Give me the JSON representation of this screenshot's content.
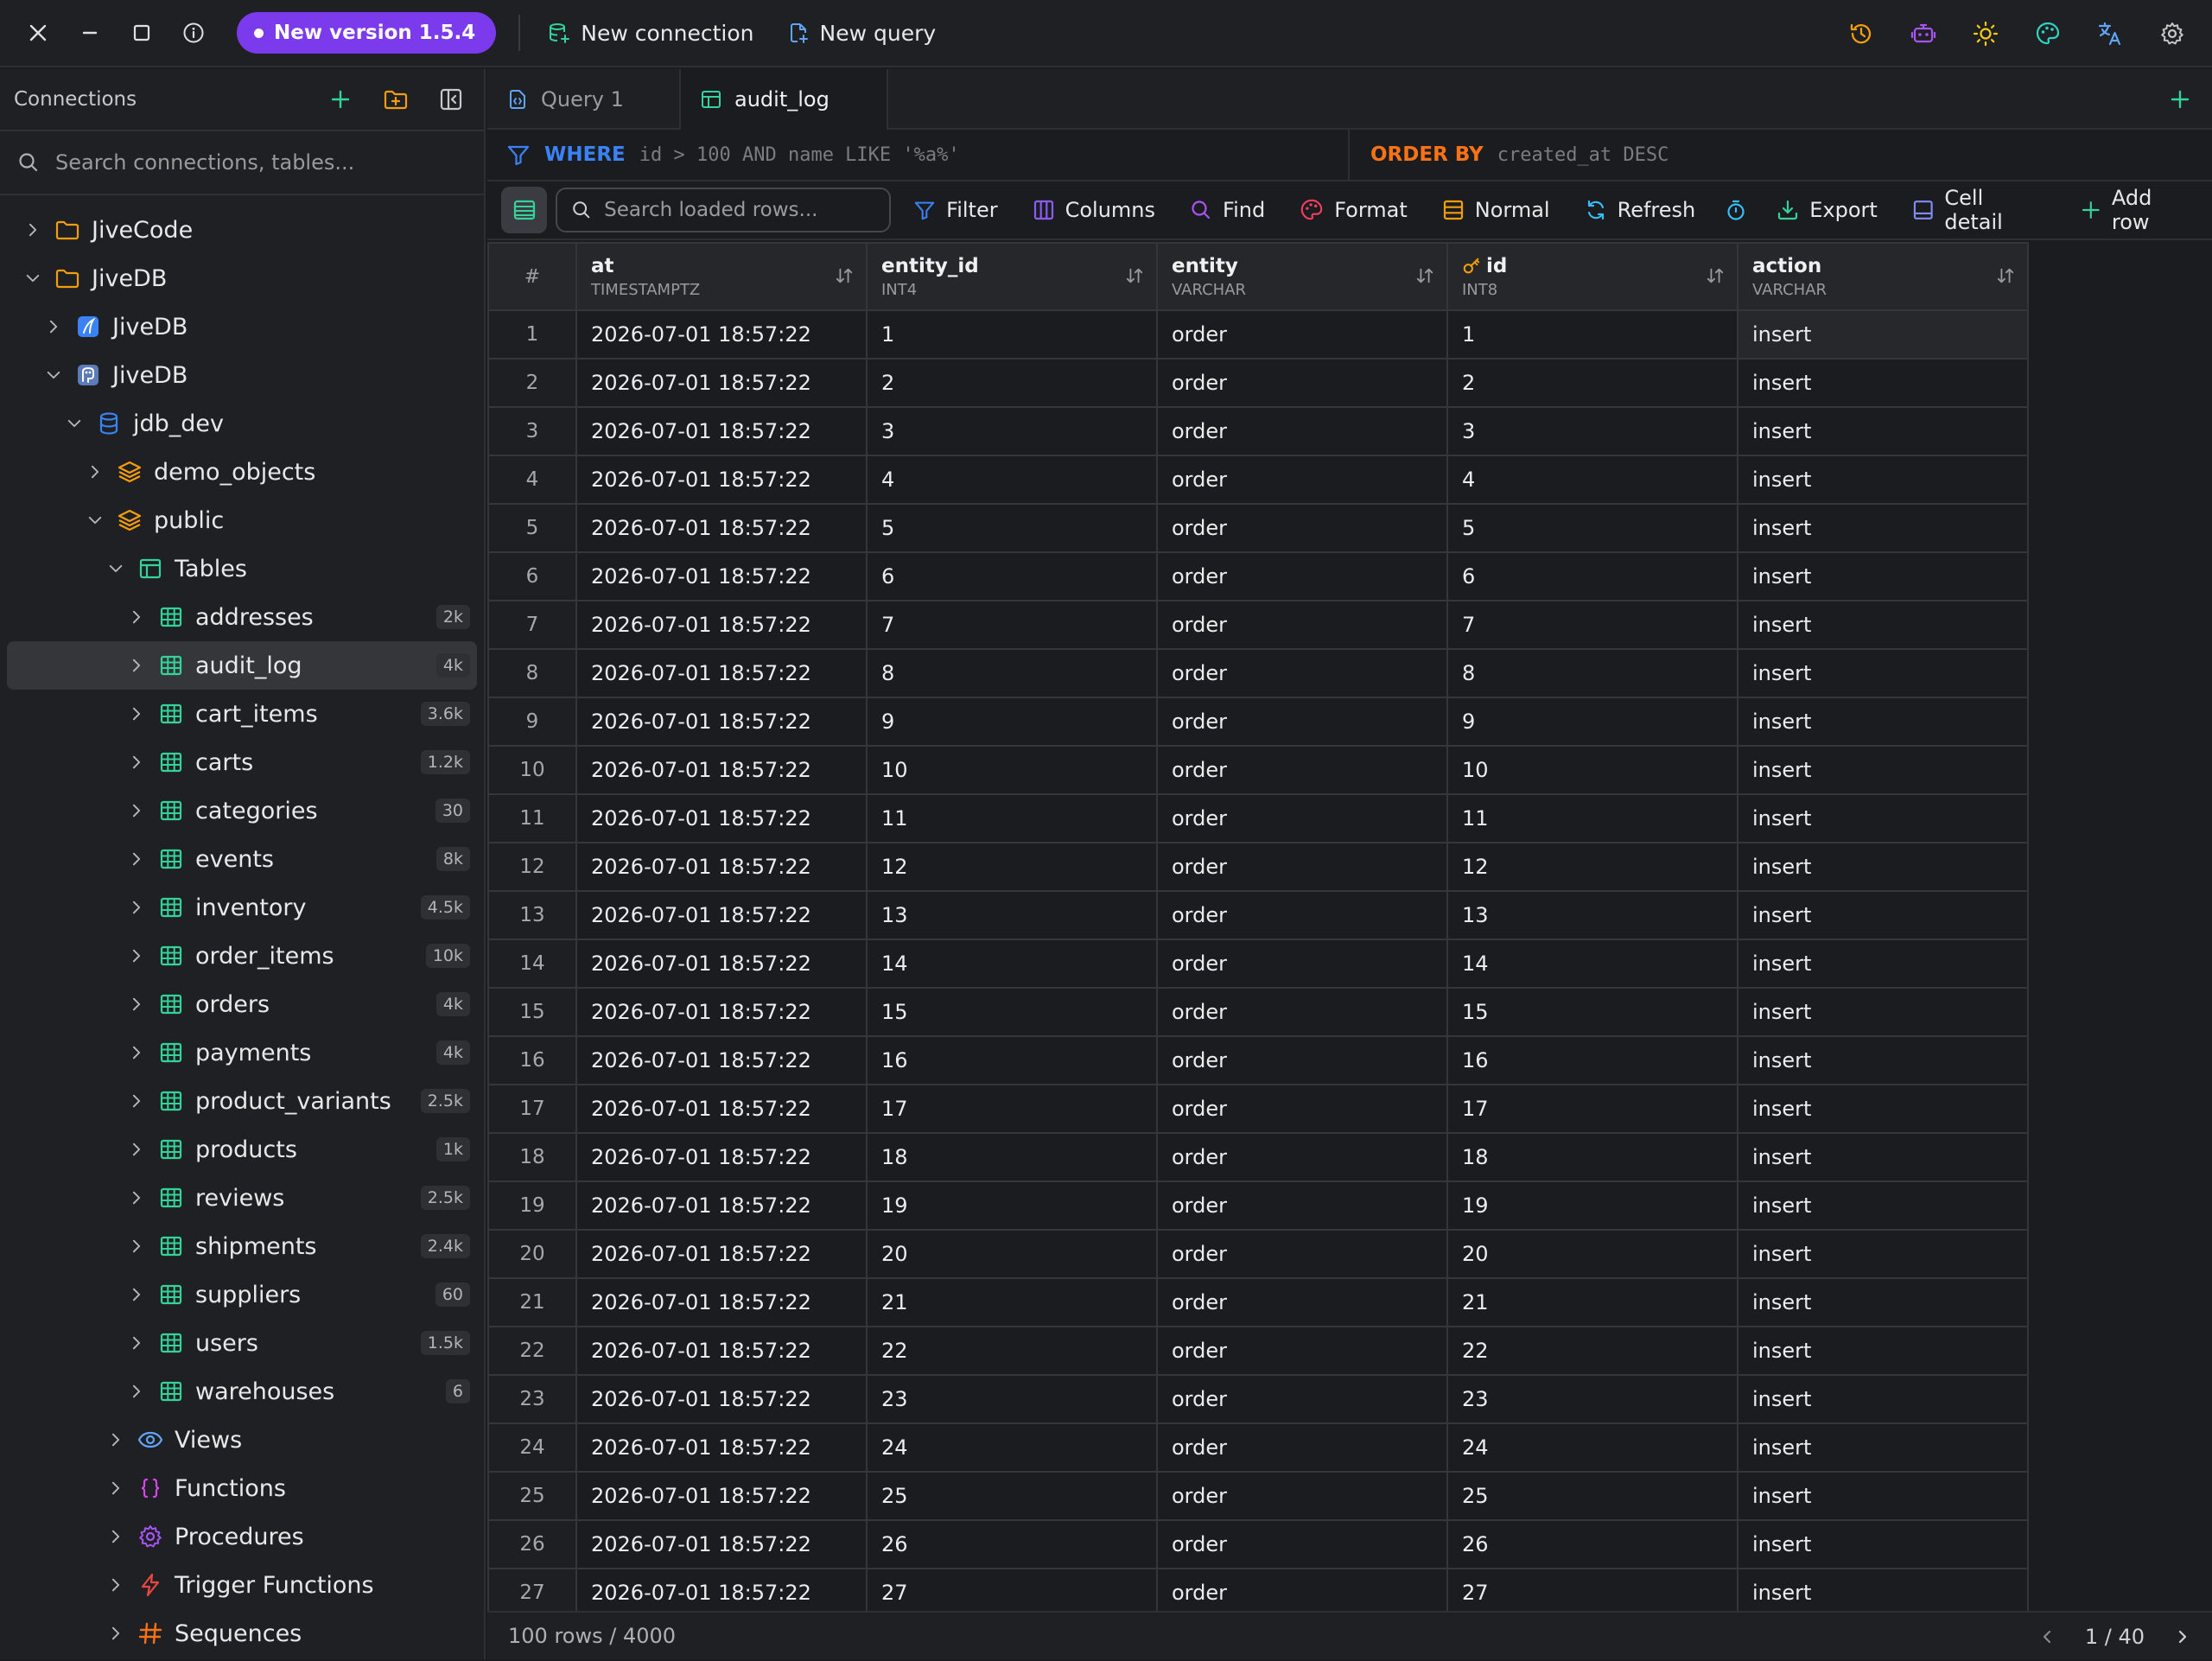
{
  "topbar": {
    "version_badge": "New version 1.5.4",
    "new_connection": "New connection",
    "new_query": "New query"
  },
  "sidebar": {
    "title": "Connections",
    "search_placeholder": "Search connections, tables...",
    "tree": [
      {
        "label": "JiveCode",
        "icon": "folder-icon",
        "level": 0,
        "expanded": false
      },
      {
        "label": "JiveDB",
        "icon": "folder-icon",
        "level": 0,
        "expanded": true
      },
      {
        "label": "JiveDB",
        "icon": "sqlite-icon",
        "level": 1,
        "expanded": false
      },
      {
        "label": "JiveDB",
        "icon": "postgres-icon",
        "level": 1,
        "expanded": true
      },
      {
        "label": "jdb_dev",
        "icon": "database-icon",
        "level": 2,
        "expanded": true
      },
      {
        "label": "demo_objects",
        "icon": "schema-icon",
        "level": 3,
        "expanded": false
      },
      {
        "label": "public",
        "icon": "schema-icon",
        "level": 3,
        "expanded": true
      },
      {
        "label": "Tables",
        "icon": "tables-icon",
        "level": 4,
        "expanded": true
      },
      {
        "label": "addresses",
        "icon": "table-icon",
        "level": 5,
        "count": "2k"
      },
      {
        "label": "audit_log",
        "icon": "table-icon",
        "level": 5,
        "count": "4k",
        "active": true
      },
      {
        "label": "cart_items",
        "icon": "table-icon",
        "level": 5,
        "count": "3.6k"
      },
      {
        "label": "carts",
        "icon": "table-icon",
        "level": 5,
        "count": "1.2k"
      },
      {
        "label": "categories",
        "icon": "table-icon",
        "level": 5,
        "count": "30"
      },
      {
        "label": "events",
        "icon": "table-icon",
        "level": 5,
        "count": "8k"
      },
      {
        "label": "inventory",
        "icon": "table-icon",
        "level": 5,
        "count": "4.5k"
      },
      {
        "label": "order_items",
        "icon": "table-icon",
        "level": 5,
        "count": "10k"
      },
      {
        "label": "orders",
        "icon": "table-icon",
        "level": 5,
        "count": "4k"
      },
      {
        "label": "payments",
        "icon": "table-icon",
        "level": 5,
        "count": "4k"
      },
      {
        "label": "product_variants",
        "icon": "table-icon",
        "level": 5,
        "count": "2.5k"
      },
      {
        "label": "products",
        "icon": "table-icon",
        "level": 5,
        "count": "1k"
      },
      {
        "label": "reviews",
        "icon": "table-icon",
        "level": 5,
        "count": "2.5k"
      },
      {
        "label": "shipments",
        "icon": "table-icon",
        "level": 5,
        "count": "2.4k"
      },
      {
        "label": "suppliers",
        "icon": "table-icon",
        "level": 5,
        "count": "60"
      },
      {
        "label": "users",
        "icon": "table-icon",
        "level": 5,
        "count": "1.5k"
      },
      {
        "label": "warehouses",
        "icon": "table-icon",
        "level": 5,
        "count": "6"
      },
      {
        "label": "Views",
        "icon": "eye-icon",
        "level": 4,
        "expanded": false
      },
      {
        "label": "Functions",
        "icon": "braces-icon",
        "level": 4,
        "expanded": false
      },
      {
        "label": "Procedures",
        "icon": "gear-icon",
        "level": 4,
        "expanded": false
      },
      {
        "label": "Trigger Functions",
        "icon": "bolt-icon",
        "level": 4,
        "expanded": false
      },
      {
        "label": "Sequences",
        "icon": "hash-icon",
        "level": 4,
        "expanded": false
      }
    ]
  },
  "tabs": [
    {
      "label": "Query 1",
      "icon": "query-file-icon",
      "active": false
    },
    {
      "label": "audit_log",
      "icon": "table-icon",
      "active": true
    }
  ],
  "filter": {
    "where_kw": "WHERE",
    "where_expr": "id > 100 AND name LIKE '%a%'",
    "order_kw": "ORDER BY",
    "order_expr": "created_at DESC"
  },
  "toolbar": {
    "search_placeholder": "Search loaded rows...",
    "filter": "Filter",
    "columns": "Columns",
    "find": "Find",
    "format": "Format",
    "normal": "Normal",
    "refresh": "Refresh",
    "export": "Export",
    "cell_detail": "Cell detail",
    "add_row": "Add row"
  },
  "grid": {
    "rownum_header": "#",
    "columns": [
      {
        "name": "at",
        "type": "TIMESTAMPTZ",
        "key": false
      },
      {
        "name": "entity_id",
        "type": "INT4",
        "key": false
      },
      {
        "name": "entity",
        "type": "VARCHAR",
        "key": false
      },
      {
        "name": "id",
        "type": "INT8",
        "key": true
      },
      {
        "name": "action",
        "type": "VARCHAR",
        "key": false
      }
    ],
    "rows": [
      [
        "1",
        "2026-07-01 18:57:22",
        "1",
        "order",
        "1",
        "insert"
      ],
      [
        "2",
        "2026-07-01 18:57:22",
        "2",
        "order",
        "2",
        "insert"
      ],
      [
        "3",
        "2026-07-01 18:57:22",
        "3",
        "order",
        "3",
        "insert"
      ],
      [
        "4",
        "2026-07-01 18:57:22",
        "4",
        "order",
        "4",
        "insert"
      ],
      [
        "5",
        "2026-07-01 18:57:22",
        "5",
        "order",
        "5",
        "insert"
      ],
      [
        "6",
        "2026-07-01 18:57:22",
        "6",
        "order",
        "6",
        "insert"
      ],
      [
        "7",
        "2026-07-01 18:57:22",
        "7",
        "order",
        "7",
        "insert"
      ],
      [
        "8",
        "2026-07-01 18:57:22",
        "8",
        "order",
        "8",
        "insert"
      ],
      [
        "9",
        "2026-07-01 18:57:22",
        "9",
        "order",
        "9",
        "insert"
      ],
      [
        "10",
        "2026-07-01 18:57:22",
        "10",
        "order",
        "10",
        "insert"
      ],
      [
        "11",
        "2026-07-01 18:57:22",
        "11",
        "order",
        "11",
        "insert"
      ],
      [
        "12",
        "2026-07-01 18:57:22",
        "12",
        "order",
        "12",
        "insert"
      ],
      [
        "13",
        "2026-07-01 18:57:22",
        "13",
        "order",
        "13",
        "insert"
      ],
      [
        "14",
        "2026-07-01 18:57:22",
        "14",
        "order",
        "14",
        "insert"
      ],
      [
        "15",
        "2026-07-01 18:57:22",
        "15",
        "order",
        "15",
        "insert"
      ],
      [
        "16",
        "2026-07-01 18:57:22",
        "16",
        "order",
        "16",
        "insert"
      ],
      [
        "17",
        "2026-07-01 18:57:22",
        "17",
        "order",
        "17",
        "insert"
      ],
      [
        "18",
        "2026-07-01 18:57:22",
        "18",
        "order",
        "18",
        "insert"
      ],
      [
        "19",
        "2026-07-01 18:57:22",
        "19",
        "order",
        "19",
        "insert"
      ],
      [
        "20",
        "2026-07-01 18:57:22",
        "20",
        "order",
        "20",
        "insert"
      ],
      [
        "21",
        "2026-07-01 18:57:22",
        "21",
        "order",
        "21",
        "insert"
      ],
      [
        "22",
        "2026-07-01 18:57:22",
        "22",
        "order",
        "22",
        "insert"
      ],
      [
        "23",
        "2026-07-01 18:57:22",
        "23",
        "order",
        "23",
        "insert"
      ],
      [
        "24",
        "2026-07-01 18:57:22",
        "24",
        "order",
        "24",
        "insert"
      ],
      [
        "25",
        "2026-07-01 18:57:22",
        "25",
        "order",
        "25",
        "insert"
      ],
      [
        "26",
        "2026-07-01 18:57:22",
        "26",
        "order",
        "26",
        "insert"
      ],
      [
        "27",
        "2026-07-01 18:57:22",
        "27",
        "order",
        "27",
        "insert"
      ]
    ]
  },
  "status": {
    "rows_text": "100 rows / 4000",
    "page": "1 / 40"
  }
}
